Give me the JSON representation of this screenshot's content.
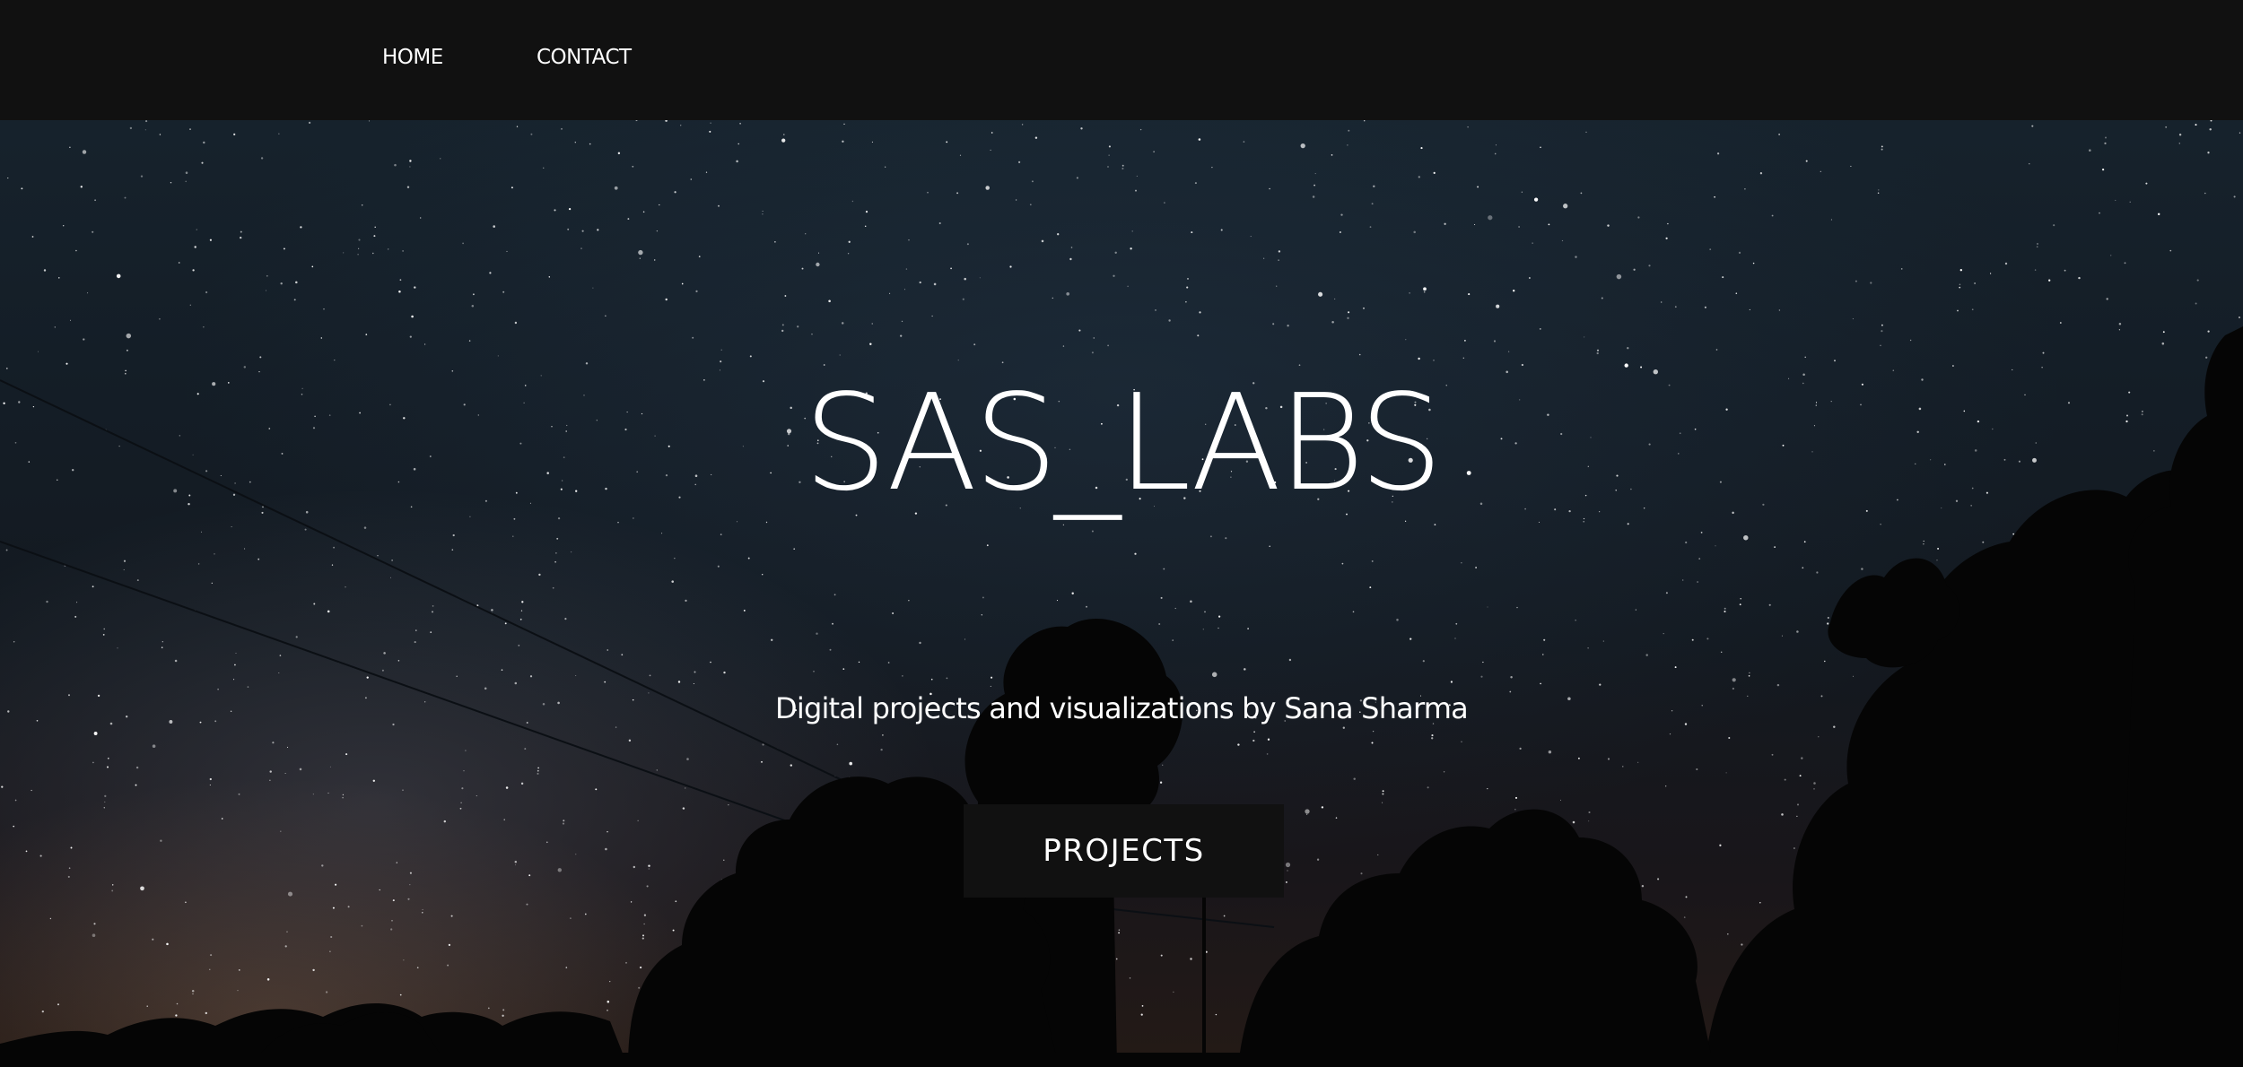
{
  "nav": {
    "items": [
      {
        "label": "HOME"
      },
      {
        "label": "CONTACT"
      }
    ]
  },
  "hero": {
    "title": "SAS_LABS",
    "subtitle": "Digital projects and visualizations by Sana Sharma",
    "button_label": "PROJECTS"
  },
  "colors": {
    "navbar_bg": "#111111",
    "button_bg": "#111111",
    "text": "#ffffff"
  }
}
